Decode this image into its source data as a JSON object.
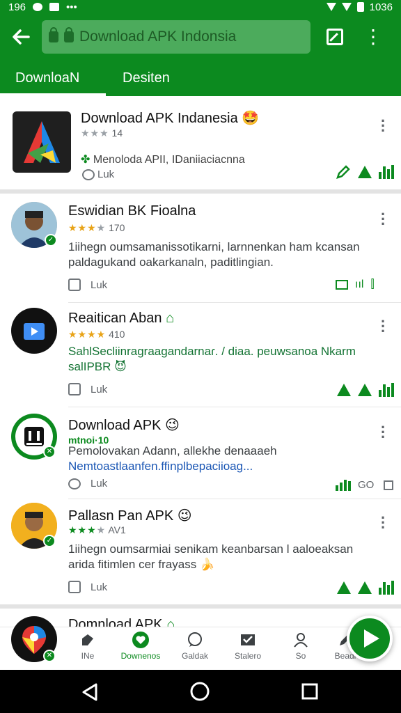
{
  "status_bar": {
    "time_left": "196",
    "time_right": "1036"
  },
  "app_bar": {
    "url_text": "Download APK Indonsia"
  },
  "tabs": [
    {
      "label": "DownloaN"
    },
    {
      "label": "Desiten"
    }
  ],
  "featured": {
    "title": "Download APK Indanesia",
    "rating_count": "14",
    "subtitle": "Menoloda APII, IDaniiaciacnna",
    "reply_label": "Luk"
  },
  "items": [
    {
      "title": "Eswidian BK Fioalna",
      "rating_count": "170",
      "desc": "1iihegn oumsamanissotikarni, larnnenkan ham kcansan paldagukand oakarkanaln, paditlingian.",
      "like_label": "Luk",
      "action_label": "ııl"
    },
    {
      "title": "Reaitican Aban",
      "rating_count": "410",
      "desc": "SahlSecliinragraagandarnaɾ. / diaa. peuwsanoa Nkarm salIPBR",
      "like_label": "Luk"
    },
    {
      "title": "Download APK",
      "rating_count": "mtnoi·10",
      "desc_line1": "Pemolovakan Adann, allekhe denaaaeh",
      "desc_line2": "Nemtoastlaanfen.ffinplbepaciioag...",
      "like_label": "Luk",
      "count_label": "GO"
    },
    {
      "title": "Pallasn Pan APK",
      "rating_count": "AV1",
      "desc": "1iihegn oumsarmiai senikam keanbarsan l aaloeaksan arida fitimlen cer frayass",
      "like_label": "Luk"
    },
    {
      "title": "Domnload APK"
    }
  ],
  "bottom_nav": [
    {
      "label": "INe"
    },
    {
      "label": "Downenos"
    },
    {
      "label": "Galdak"
    },
    {
      "label": "Stalero"
    },
    {
      "label": "So"
    },
    {
      "label": "Beadi"
    }
  ],
  "colors": {
    "brand_green": "#0c8a1f",
    "star_orange": "#e8a317"
  }
}
